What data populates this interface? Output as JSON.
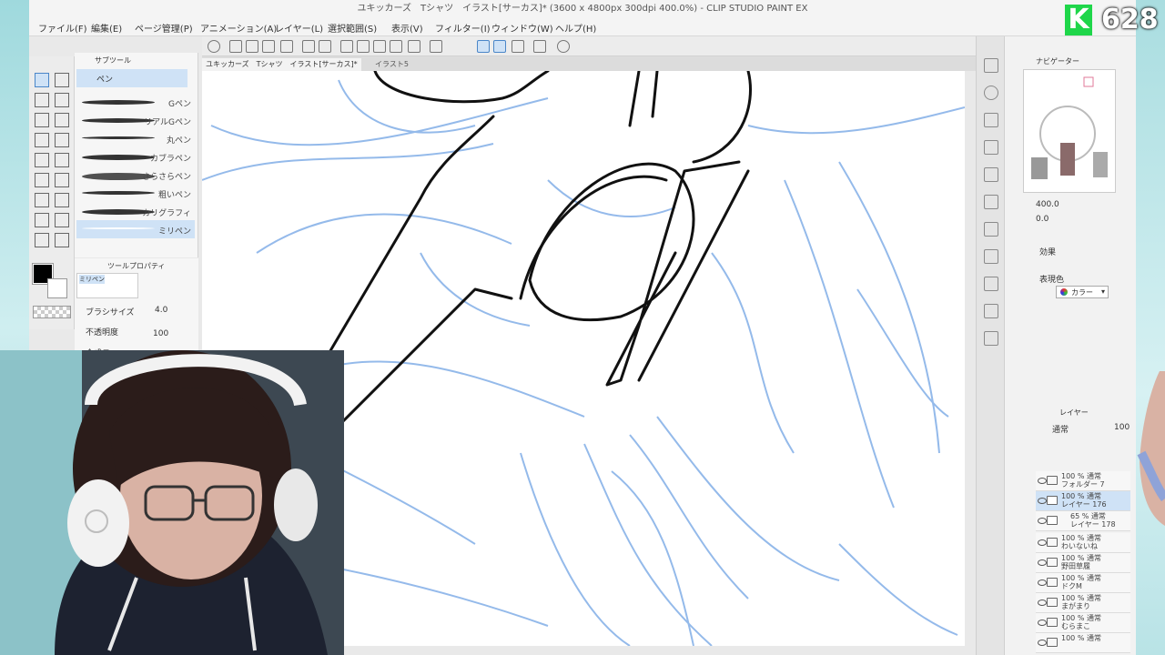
{
  "window": {
    "title": "ユキッカーズ　Tシャツ　イラスト[サーカス]* (3600 x 4800px 300dpi 400.0%) - CLIP STUDIO PAINT EX"
  },
  "menu": [
    "ファイル(F)",
    "編集(E)",
    "ページ管理(P)",
    "アニメーション(A)",
    "レイヤー(L)",
    "選択範囲(S)",
    "表示(V)",
    "フィルター(I)",
    "ウィンドウ(W)",
    "ヘルプ(H)"
  ],
  "canvas_tabs": [
    "ユキッカーズ　Tシャツ　イラスト[サーカス]*",
    "イラスト5"
  ],
  "subtool": {
    "header": "サブツール",
    "group": "ペン",
    "brushes": [
      "Gペン",
      "リアルGペン",
      "丸ペン",
      "カブラペン",
      "さらさらペン",
      "粗いペン",
      "カリグラフィ",
      "ミリペン"
    ]
  },
  "tool_property": {
    "header": "ツールプロパティ",
    "brush_name": "ミリペン",
    "brush_size_label": "ブラシサイズ",
    "brush_size_value": "4.0",
    "opacity_label": "不透明度",
    "opacity_value": "100",
    "blend_label": "合成モ"
  },
  "navigator": {
    "header": "ナビゲーター",
    "zoom_value": "400.0",
    "rotate_value": "0.0"
  },
  "effects": {
    "header": "効果",
    "expression_label": "表現色",
    "expression_value": "カラー"
  },
  "layers": {
    "header": "レイヤー",
    "blend_mode": "通常",
    "opacity": "100",
    "items": [
      {
        "line1": "100 % 通常",
        "line2": "フォルダー 7",
        "selected": false
      },
      {
        "line1": "100 % 通常",
        "line2": "レイヤー 176",
        "selected": true
      },
      {
        "line1": "65 % 通常",
        "line2": "レイヤー 178",
        "selected": false
      },
      {
        "line1": "100 % 通常",
        "line2": "わいないね",
        "selected": false
      },
      {
        "line1": "100 % 通常",
        "line2": "野田草履",
        "selected": false
      },
      {
        "line1": "100 % 通常",
        "line2": "ドクM",
        "selected": false
      },
      {
        "line1": "100 % 通常",
        "line2": "まがまり",
        "selected": false
      },
      {
        "line1": "100 % 通常",
        "line2": "むらまこ",
        "selected": false
      },
      {
        "line1": "100 % 通常",
        "line2": "",
        "selected": false
      }
    ]
  },
  "stream_badge": {
    "letter": "K",
    "count": "628"
  },
  "colors": {
    "sketch_blue": "#7aa9e6",
    "lineart": "#111111",
    "accent_green": "#1fd64a",
    "selected_layer": "#cfe2f6"
  }
}
